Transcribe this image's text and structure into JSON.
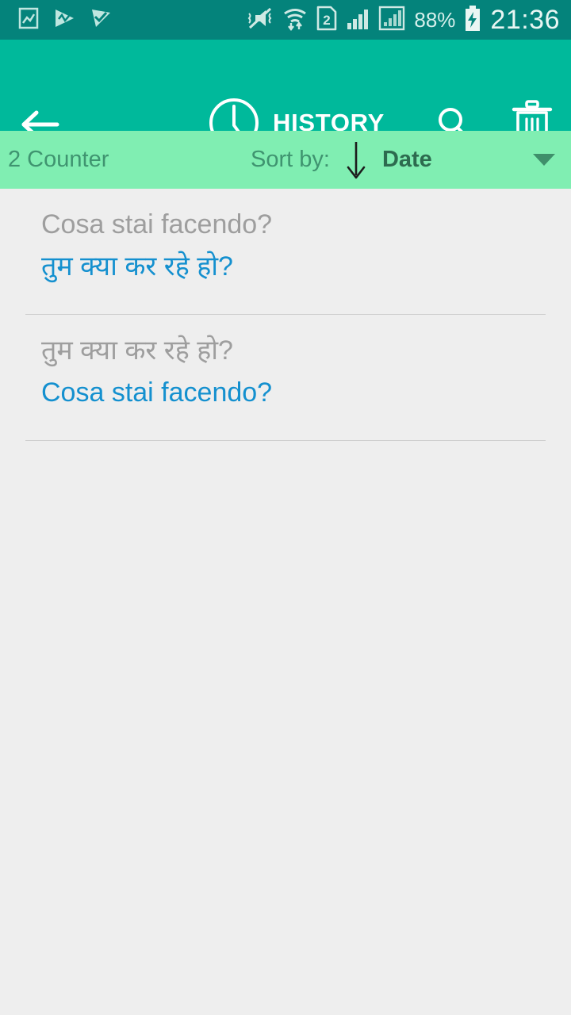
{
  "status_bar": {
    "background_color": "#04837b",
    "left_icons": [
      "image-icon",
      "media-play-icon",
      "media-check-icon"
    ],
    "right_icons": [
      "mute-vibrate-icon",
      "wifi-data-icon",
      "sim2-icon",
      "signal-bars-icon",
      "signal-framed-icon"
    ],
    "battery_percent": "88%",
    "battery_state": "charging",
    "clock": "21:36"
  },
  "toolbar": {
    "background_color": "#00b99b",
    "back_label": "Back",
    "title": "HISTORY",
    "title_icon": "clock-icon",
    "search_label": "Search",
    "delete_label": "Delete all"
  },
  "sort_bar": {
    "background_color": "#80eeb2",
    "counter": "2 Counter",
    "sort_by_label": "Sort by:",
    "sort_direction": "descending",
    "sort_value": "Date",
    "caret": "chevron-down-icon"
  },
  "history": {
    "accent_color": "#1490cf",
    "muted_color": "#9e9e9e",
    "items": [
      {
        "source_text": "Cosa stai facendo?",
        "target_text": "तुम क्या कर रहे हो?"
      },
      {
        "source_text": "तुम क्या कर रहे हो?",
        "target_text": "Cosa stai facendo?"
      }
    ]
  }
}
